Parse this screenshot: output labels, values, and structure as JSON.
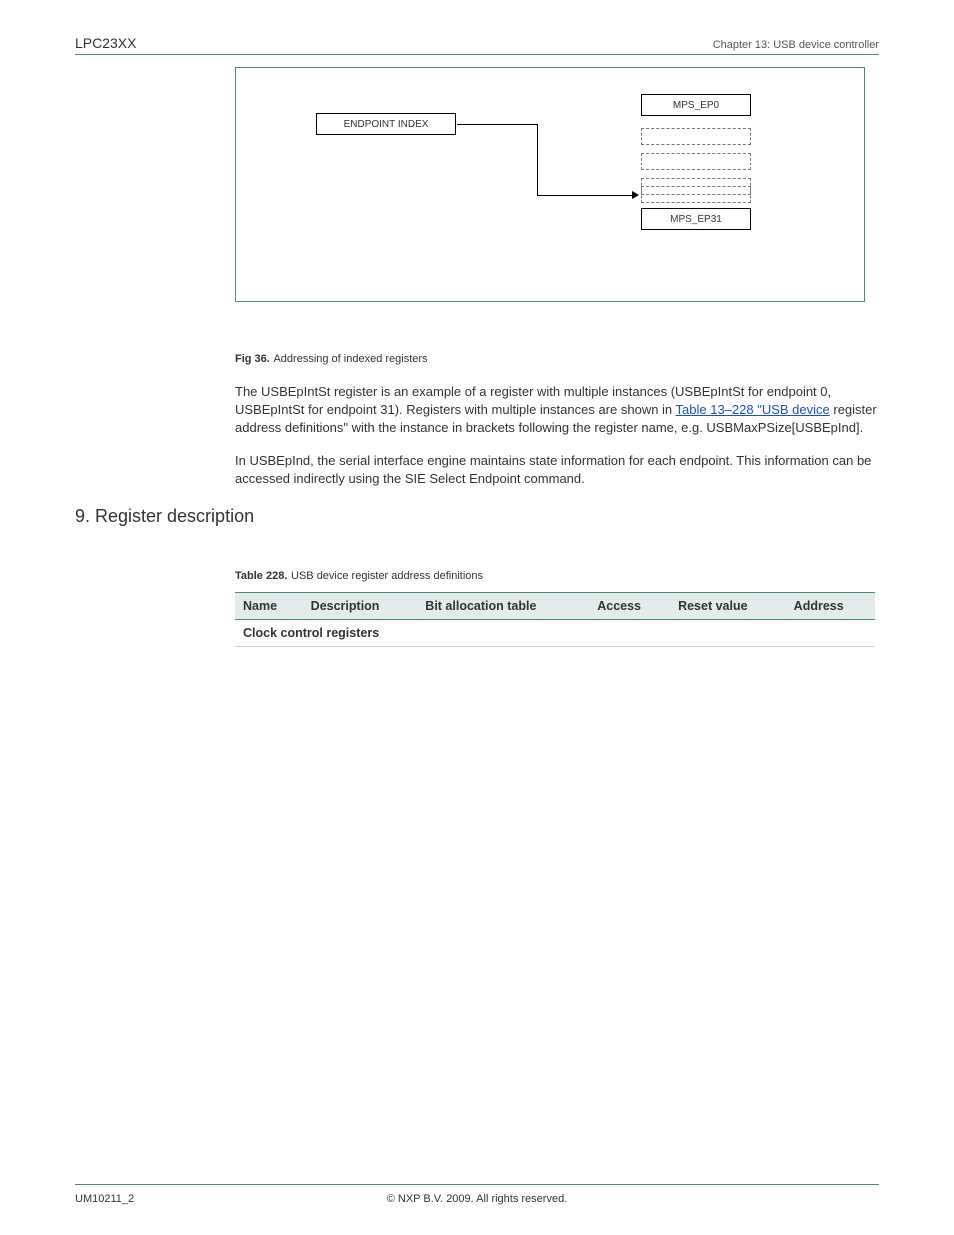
{
  "header": {
    "product": "LPC23XX",
    "chapter": "Chapter 13: USB device controller"
  },
  "figure": {
    "label": "Fig 36.",
    "text": "Addressing of indexed registers",
    "endpoint_index": "ENDPOINT INDEX",
    "mps_ep0": "MPS_EP0",
    "mps_ep31": "MPS_EP31"
  },
  "link": {
    "table_228": "Table 13–228 \"USB device"
  },
  "para": {
    "p1_a": "The USBEpIntSt register is an example of a register with multiple instances (USBEpIntSt for endpoint 0, USBEpIntSt for endpoint 31). Registers with multiple instances are shown in ",
    "p1_b": " register address definitions\" with the instance in brackets following the register name, e.g. USBMaxPSize[USBEpInd].",
    "p2": "In USBEpInd, the serial interface engine maintains state information for each endpoint. This information can be accessed indirectly using the SIE Select Endpoint command.",
    "h1": "9. Register description",
    "h2": " ",
    "p3": "",
    "p4": ""
  },
  "table228": {
    "title_label": "Table 228.",
    "title_text": "USB device register address definitions",
    "cols": [
      "Name",
      "Description",
      "Bit allocation table",
      "Access",
      "Reset value",
      "Address"
    ],
    "row_hdr": "Clock control registers"
  },
  "footer": {
    "left": "UM10211_2",
    "center": "© NXP B.V. 2009. All rights reserved.",
    "right": ""
  }
}
